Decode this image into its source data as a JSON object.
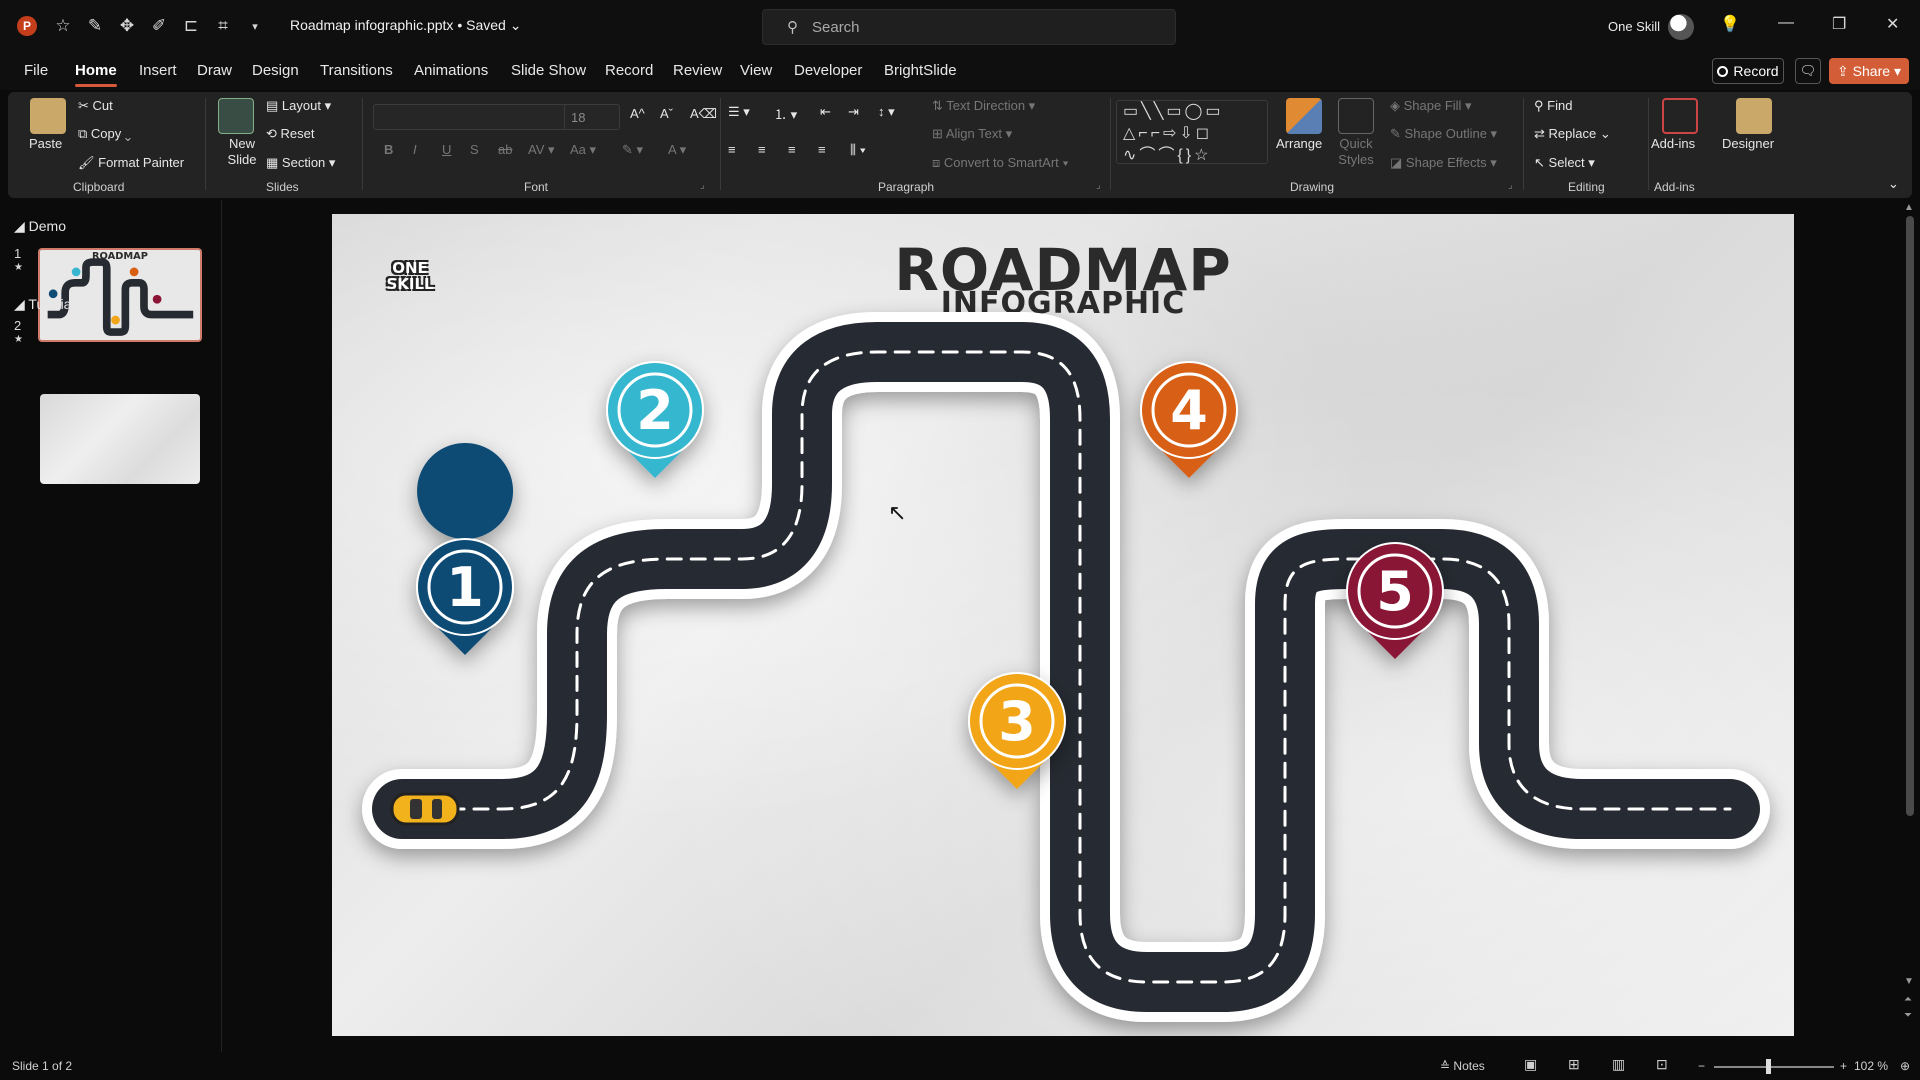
{
  "window": {
    "file_name": "Roadmap infographic.pptx • Saved",
    "search_placeholder": "Search",
    "user_name": "One Skill"
  },
  "menu": {
    "tabs": [
      "File",
      "Home",
      "Insert",
      "Draw",
      "Design",
      "Transitions",
      "Animations",
      "Slide Show",
      "Record",
      "Review",
      "View",
      "Developer",
      "BrightSlide"
    ],
    "active": "Home",
    "record_label": "Record",
    "share_label": "Share"
  },
  "ribbon": {
    "clipboard": {
      "paste": "Paste",
      "cut": "Cut",
      "copy": "Copy",
      "format_painter": "Format Painter",
      "label": "Clipboard"
    },
    "slides": {
      "new_slide": "New Slide",
      "layout": "Layout",
      "reset": "Reset",
      "section": "Section",
      "label": "Slides"
    },
    "font": {
      "size": "18",
      "label": "Font"
    },
    "paragraph": {
      "text_direction": "Text Direction",
      "align_text": "Align Text",
      "convert_smartart": "Convert to SmartArt",
      "label": "Paragraph"
    },
    "drawing": {
      "arrange": "Arrange",
      "quick_styles": "Quick Styles",
      "shape_fill": "Shape Fill",
      "shape_outline": "Shape Outline",
      "shape_effects": "Shape Effects",
      "label": "Drawing"
    },
    "editing": {
      "find": "Find",
      "replace": "Replace",
      "select": "Select",
      "label": "Editing"
    },
    "addins": {
      "addins": "Add-ins",
      "designer": "Designer",
      "label": "Add-ins"
    }
  },
  "slides_pane": {
    "sections": [
      {
        "name": "Demo",
        "slide_number": "1"
      },
      {
        "name": "Tutorial",
        "slide_number": "2"
      }
    ]
  },
  "slide": {
    "logo_line1": "ONE",
    "logo_line2": "SKILL",
    "title": "ROADMAP",
    "subtitle": "INFOGRAPHIC",
    "road_color": "#262a31",
    "pins": [
      {
        "label": "1",
        "color": "#0f4c75"
      },
      {
        "label": "2",
        "color": "#36b7cf"
      },
      {
        "label": "3",
        "color": "#f2a516"
      },
      {
        "label": "4",
        "color": "#d85f12"
      },
      {
        "label": "5",
        "color": "#8a1535"
      }
    ],
    "car_color": "#f2b21b"
  },
  "status": {
    "slide_info": "Slide 1 of 2",
    "notes": "Notes",
    "zoom": "102 %"
  }
}
